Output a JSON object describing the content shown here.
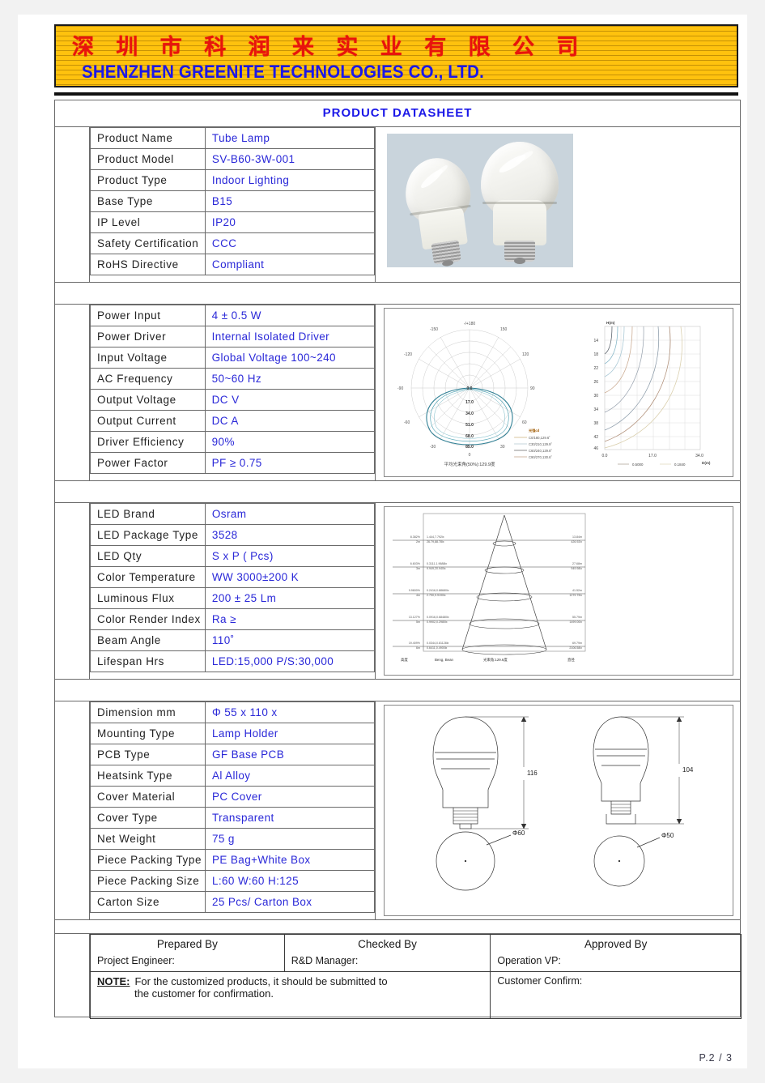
{
  "company": {
    "name_cn": "深 圳 市 科 润 来 实 业 有 限 公 司",
    "name_en": "SHENZHEN GREENITE TECHNOLOGIES CO., LTD."
  },
  "document": {
    "title": "PRODUCT  DATASHEET",
    "page_number": "P.2 / 3"
  },
  "sections": [
    {
      "id": "product",
      "rows": [
        {
          "label": "Product Name",
          "value": "Tube Lamp"
        },
        {
          "label": "Product Model",
          "value": "SV-B60-3W-001"
        },
        {
          "label": "Product Type",
          "value": "Indoor Lighting"
        },
        {
          "label": "Base Type",
          "value": "B15"
        },
        {
          "label": "IP Level",
          "value": "IP20"
        },
        {
          "label": "Safety Certification",
          "value": "CCC"
        },
        {
          "label": "RoHS Directive",
          "value": "Compliant"
        }
      ]
    },
    {
      "id": "power",
      "rows": [
        {
          "label": "Power Input",
          "value": "4  ±  0.5 W"
        },
        {
          "label": "Power Driver",
          "value": "Internal  Isolated  Driver"
        },
        {
          "label": "Input Voltage",
          "value": "Global  Voltage  100~240"
        },
        {
          "label": "AC Frequency",
          "value": "50~60  Hz"
        },
        {
          "label": "Output Voltage",
          "value": "DC           V"
        },
        {
          "label": "Output Current",
          "value": "DC           A"
        },
        {
          "label": "Driver Efficiency",
          "value": "90%"
        },
        {
          "label": "Power Factor",
          "value": "PF ≥ 0.75"
        }
      ]
    },
    {
      "id": "led",
      "rows": [
        {
          "label": "LED Brand",
          "value": "Osram"
        },
        {
          "label": "LED Package Type",
          "value": "3528"
        },
        {
          "label": "LED Qty",
          "value": "    S x     P (      Pcs)"
        },
        {
          "label": "Color Temperature",
          "value": "WW  3000±200  K"
        },
        {
          "label": "Luminous Flux",
          "value": "200  ±  25 Lm"
        },
        {
          "label": "Color Render Index",
          "value": "Ra ≥"
        },
        {
          "label": "Beam Angle",
          "value": "110˚"
        },
        {
          "label": "Lifespan Hrs",
          "value": "LED:15,000  P/S:30,000"
        }
      ]
    },
    {
      "id": "mechanical",
      "rows": [
        {
          "label": "Dimension mm",
          "value": "Φ  55 x 110 x"
        },
        {
          "label": "Mounting Type",
          "value": "Lamp Holder"
        },
        {
          "label": "PCB Type",
          "value": "GF Base PCB"
        },
        {
          "label": "Heatsink Type",
          "value": "Al Alloy"
        },
        {
          "label": "Cover Material",
          "value": "PC Cover"
        },
        {
          "label": "Cover Type",
          "value": "Transparent"
        },
        {
          "label": "Net Weight",
          "value": "75 g"
        },
        {
          "label": "Piece Packing Type",
          "value": "PE Bag+White Box"
        },
        {
          "label": "Piece Packing Size",
          "value": "L:60 W:60 H:125"
        },
        {
          "label": "Carton Size",
          "value": "25 Pcs/  Carton Box"
        }
      ]
    }
  ],
  "signature": {
    "prepared_by": "Prepared By",
    "prepared_role": "Project Engineer:",
    "checked_by": "Checked By",
    "checked_role": "R&D Manager:",
    "approved_by": "Approved By",
    "approved_role": "Operation VP:",
    "note_label": "NOTE:",
    "note_line1": "For the customized products, it should be submitted to",
    "note_line2": "the customer for confirmation.",
    "customer_confirm": "Customer Confirm:"
  },
  "chart_data": [
    {
      "type": "line",
      "id": "polar-light-distribution",
      "title": "",
      "notes": "Polar luminous intensity distribution curve",
      "angle_labels": [
        "-/+180",
        "-150",
        "150",
        "-120",
        "120",
        "-90",
        "90",
        "-60",
        "60",
        "-30",
        "30",
        "0"
      ],
      "radial_ticks": [
        "0.0",
        "17.0",
        "34.0",
        "51.0",
        "68.0",
        "85.0"
      ],
      "legend_title": "光强cd",
      "legend": [
        "C0/180,129.6˚",
        "C30/210,129.9˚",
        "C60/240,129.8˚",
        "C90/270,130.6˚"
      ],
      "footer": "平均光束角(50%):129.9度"
    },
    {
      "type": "line",
      "id": "isolux-contour",
      "title": "",
      "notes": "Illuminance / isolux contour plot",
      "ylabel": "H(m)",
      "xlabel": "D(m)",
      "yticks": [
        "14",
        "18",
        "22",
        "26",
        "30",
        "34",
        "38",
        "42",
        "46"
      ],
      "xticks": [
        "0.0",
        "17.0",
        "34.0"
      ],
      "legend": [
        "0.5000",
        "0.1840"
      ]
    },
    {
      "type": "line",
      "id": "beam-cone-diagram",
      "title": "",
      "notes": "Beam spread cone diagram with illuminance at heights",
      "axis_labels": [
        "高度",
        "Beng, Bean",
        "光束角:129.6度",
        "直径"
      ],
      "rows": [
        {
          "pct": "8.382%",
          "h": "2m",
          "left": "1.444,7.792lx",
          "left2": "26.79,88.78lx",
          "right": "13.84m",
          "right2": "426.92lx"
        },
        {
          "pct": "6.603%",
          "h": "3m",
          "left": "0.3111,1.9688lx",
          "left2": "9.949,20.940lx",
          "right": "27.68m",
          "right2": "949.98lx"
        },
        {
          "pct": "9.9600%",
          "h": "4m",
          "left": "0.2416,0.88680lx",
          "left2": "2.790,9.9190lx",
          "right": "41.52m",
          "right2": "1279.79lx"
        },
        {
          "pct": "13.127%",
          "h": "5m",
          "left": "0.0916,0.68480lx",
          "left2": "0.9902,0.2980lx",
          "right": "55.79m",
          "right2": "1499.00lx"
        },
        {
          "pct": "19.409%",
          "h": "6m",
          "left": "0.0344,0.81128lx",
          "left2": "0.6411,0.4900lx",
          "right": "69.79m",
          "right2": "2106.58lx"
        }
      ]
    }
  ],
  "drawings": {
    "left_height": "116",
    "left_diameter": "Φ60",
    "right_height": "104",
    "right_diameter": "Φ50"
  },
  "icons": {
    "bulb_photo": "led-bulb-photo",
    "polar_chart": "polar-chart-icon",
    "contour_chart": "contour-chart-icon"
  },
  "colors": {
    "banner_bg": "#FFC20E",
    "banner_cn_text": "#E8140C",
    "banner_en_text": "#1B18E8",
    "title_blue": "#1B18E8",
    "value_blue": "#2A28D8",
    "label_dark": "#222222",
    "border_gray": "#6a6a6a"
  }
}
